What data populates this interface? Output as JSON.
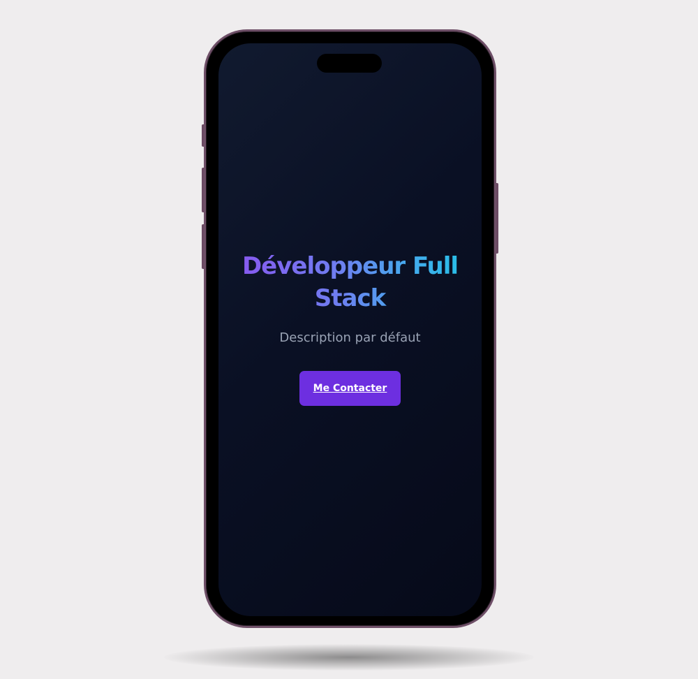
{
  "hero": {
    "title": "Développeur Full Stack",
    "description": "Description par défaut",
    "contact_button_label": "Me Contacter"
  },
  "colors": {
    "background": "#efedee",
    "phone_frame": "#6f5068",
    "screen": "#0a1024",
    "title_gradient_start": "#8a55ef",
    "title_gradient_end": "#22c3e6",
    "description": "#9aa3b5",
    "button": "#6d2fe0",
    "button_text": "#ffffff"
  }
}
